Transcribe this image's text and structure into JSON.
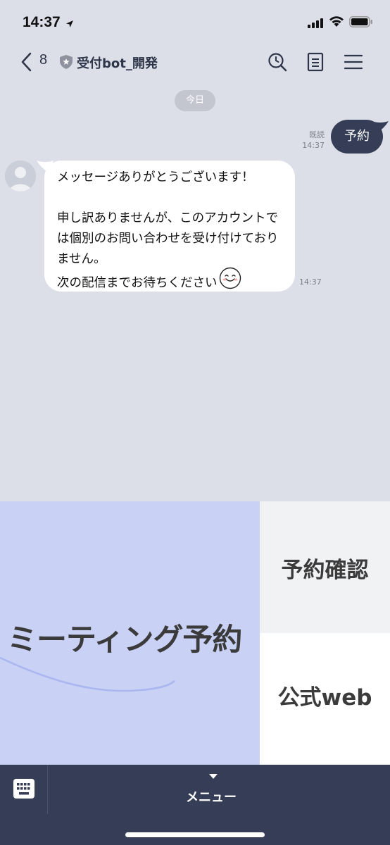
{
  "status_bar": {
    "time": "14:37"
  },
  "header": {
    "unread_count": "8",
    "title": "受付bot_開発"
  },
  "chat": {
    "date_label": "今日",
    "sent": {
      "read_label": "既読",
      "time": "14:37",
      "text": "予約"
    },
    "received": {
      "text": "メッセージありがとうございます！\n\n申し訳ありませんが、このアカウントでは個別のお問い合わせを受け付けておりません。\n次の配信までお待ちください",
      "time": "14:37"
    }
  },
  "rich_menu": {
    "main_label": "ミーティング予約",
    "confirm_label": "予約確認",
    "web_label": "公式web"
  },
  "bottom_bar": {
    "menu_label": "メニュー"
  },
  "colors": {
    "header_text": "#2e3548",
    "sent_bubble": "#353e56",
    "chat_bg": "#dcdfe8",
    "rich_main_bg": "#c9d1f5"
  }
}
